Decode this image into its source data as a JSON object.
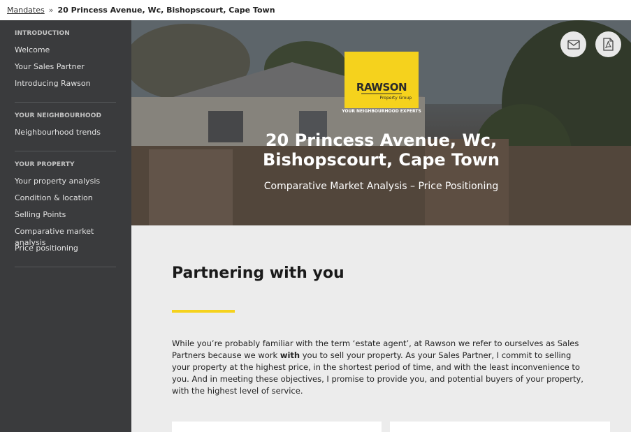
{
  "breadcrumb": {
    "link": "Mandates",
    "separator": "»",
    "current": "20 Princess Avenue, Wc, Bishopscourt, Cape Town"
  },
  "sidebar": {
    "sections": [
      {
        "title": "INTRODUCTION",
        "items": [
          "Welcome",
          "Your Sales Partner",
          "Introducing Rawson"
        ]
      },
      {
        "title": "YOUR NEIGHBOURHOOD",
        "items": [
          "Neighbourhood trends"
        ]
      },
      {
        "title": "YOUR PROPERTY",
        "items": [
          "Your property analysis",
          "Condition & location",
          "Selling Points",
          "Comparative market analysis",
          "Price positioning"
        ]
      }
    ]
  },
  "hero": {
    "logo_word": "RAWSON",
    "logo_sub": "Property Group",
    "tagline": "YOUR NEIGHBOURHOOD EXPERTS",
    "title": "20 Princess Avenue, Wc, Bishopscourt, Cape Town",
    "subtitle": "Comparative Market Analysis – Price Positioning",
    "buttons": {
      "email_icon": "envelope-icon",
      "pdf_icon": "pdf-icon"
    }
  },
  "main": {
    "heading": "Partnering with you",
    "para_1": "While you’re probably familiar with the term ‘estate agent’, at Rawson we refer to ourselves as Sales Partners because we work ",
    "para_bold": "with",
    "para_2": " you to sell your property. As your Sales Partner, I commit to selling your property at the highest price, in the shortest period of time, and with the least inconvenience to you. And in meeting these objectives, I promise to provide you, and potential buyers of your property, with the highest level of service."
  },
  "colors": {
    "accent": "#f5d21d",
    "sidebar": "#3a3b3d",
    "content_bg": "#ececec"
  }
}
